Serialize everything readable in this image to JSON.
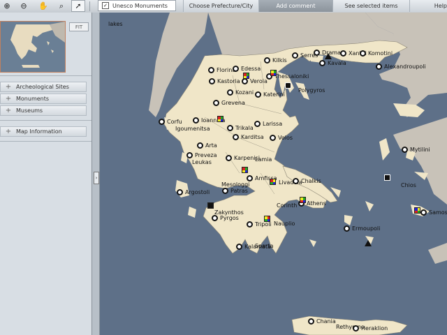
{
  "toolbar": {
    "tools": [
      {
        "name": "zoom-in-icon",
        "glyph": "⊕"
      },
      {
        "name": "zoom-out-icon",
        "glyph": "⊖"
      },
      {
        "name": "pan-hand-icon",
        "glyph": "✋"
      },
      {
        "name": "zoom-box-icon",
        "glyph": "⌕"
      },
      {
        "name": "pointer-icon",
        "glyph": "➚"
      }
    ],
    "unesco_label": "Unesco Monuments",
    "unesco_checked": true,
    "tabs": {
      "prefecture": "Choose Prefecture/City",
      "add_comment": "Add comment",
      "see_selected": "See selected items",
      "help": "Help"
    }
  },
  "panel": {
    "fit_label": "FIT",
    "items": [
      {
        "plus": "+",
        "label": "Archeological Sites"
      },
      {
        "plus": "+",
        "label": "Monuments"
      },
      {
        "plus": "+",
        "label": "Museums"
      },
      {
        "plus": "+",
        "label": "Map Information"
      }
    ]
  },
  "map": {
    "layer_label": "lakes",
    "cities": [
      "Florina",
      "Edessa",
      "Thessaloniki",
      "Kilkis",
      "Serres",
      "Drama",
      "Xanthi",
      "Komotini",
      "Kavala",
      "Alexandroupoli",
      "Kastoria",
      "Veroia",
      "Kozani",
      "Katerini",
      "Polygyros",
      "Grevena",
      "Ioannina",
      "Corfu",
      "Igoumenitsa",
      "Trikala",
      "Larissa",
      "Karditsa",
      "Volos",
      "Arta",
      "Preveza",
      "Leukas",
      "Karpenisi",
      "Lamia",
      "Amfissa",
      "Livadeia",
      "Chalkis",
      "Mytilini",
      "Chios",
      "Samos",
      "Argostoli",
      "Mesologgi",
      "Patras",
      "Corinth",
      "Athens",
      "Zakynthos",
      "Pyrgos",
      "Tripoli",
      "Nauplio",
      "Ermoupoli",
      "Kalamata",
      "Sparta",
      "Chania",
      "Rethymno",
      "Heraklion"
    ]
  },
  "colors": {
    "sea": "#5e7088",
    "land": "#f0e6c8",
    "neighbor_land": "#c8c2b8",
    "toolbar": "#c6ccd2",
    "panel": "#d8dee4"
  }
}
